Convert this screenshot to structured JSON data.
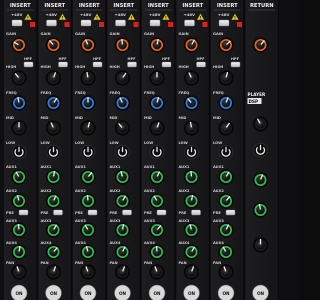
{
  "mixer": {
    "channel_headers": [
      "INSERT",
      "INSERT",
      "INSERT",
      "INSERT",
      "INSERT",
      "INSERT",
      "INSERT",
      "RETURN"
    ],
    "phantom_label": "+48V",
    "gain_label": "GAIN",
    "hpf_label": "HPF",
    "high_label": "HIGH",
    "freq_label": "FREQ",
    "mid_label": "MID",
    "low_label": "LOW",
    "aux_labels": [
      "AUX1",
      "AUX2",
      "AUX3",
      "AUX4"
    ],
    "pre_label": "PRE",
    "pan_label": "PAN",
    "on_label": "ON",
    "player_label": "PLAYER",
    "dsp_label": "DSP"
  },
  "colors": {
    "panel": "#1a1a1c",
    "gain_knob": "#e0661e",
    "eq_knob": "#2f7fe0",
    "aux_knob": "#2fbf4a",
    "pan_knob": "#d8d8d8",
    "led_red": "#e01e1e",
    "warning_yellow": "#e8c020"
  },
  "icons": [
    "warning-triangle-icon",
    "knob-icon",
    "power-button-icon"
  ]
}
